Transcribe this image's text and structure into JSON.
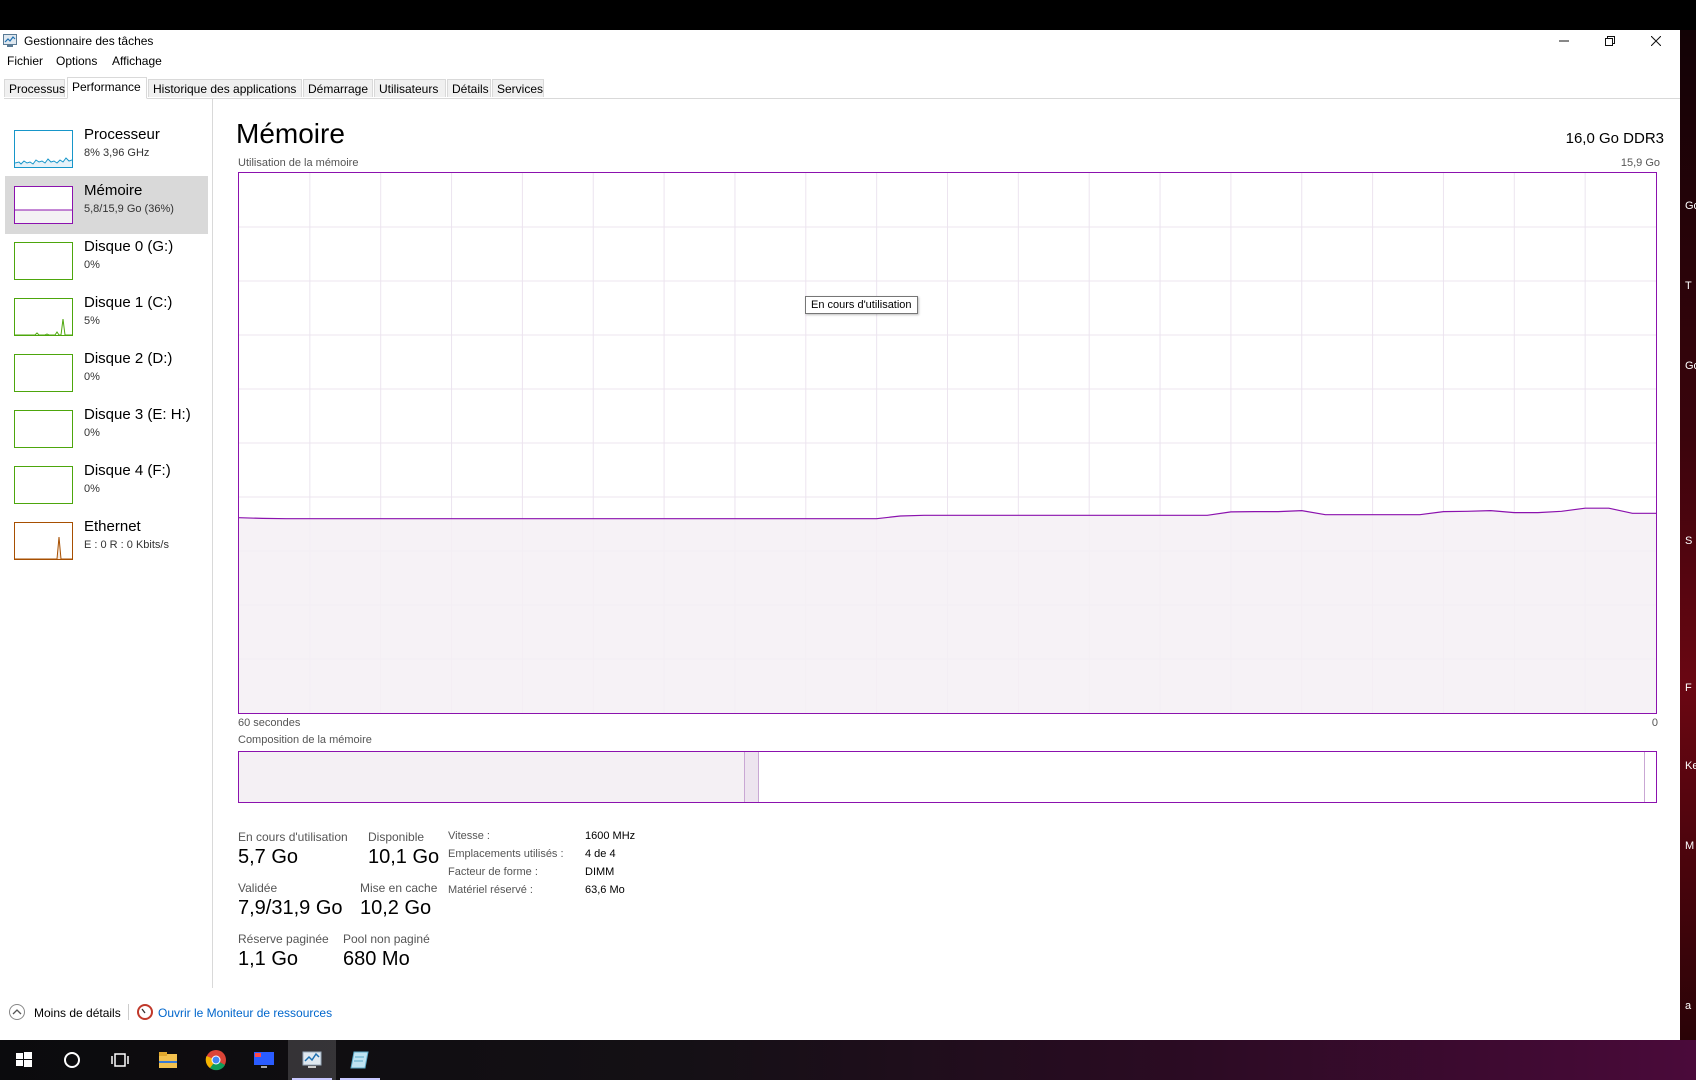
{
  "window": {
    "title": "Gestionnaire des tâches"
  },
  "menu": [
    "Fichier",
    "Options",
    "Affichage"
  ],
  "tabs": [
    "Processus",
    "Performance",
    "Historique des applications",
    "Démarrage",
    "Utilisateurs",
    "Détails",
    "Services"
  ],
  "active_tab": "Performance",
  "sidebar": [
    {
      "title": "Processeur",
      "sub": "8% 3,96 GHz",
      "color": "#1796c9",
      "selected": false
    },
    {
      "title": "Mémoire",
      "sub": "5,8/15,9 Go (36%)",
      "color": "#8b12ae",
      "selected": true
    },
    {
      "title": "Disque 0 (G:)",
      "sub": "0%",
      "color": "#4da60c",
      "selected": false
    },
    {
      "title": "Disque 1 (C:)",
      "sub": "5%",
      "color": "#4da60c",
      "selected": false
    },
    {
      "title": "Disque 2 (D:)",
      "sub": "0%",
      "color": "#4da60c",
      "selected": false
    },
    {
      "title": "Disque 3 (E: H:)",
      "sub": "0%",
      "color": "#4da60c",
      "selected": false
    },
    {
      "title": "Disque 4 (F:)",
      "sub": "0%",
      "color": "#4da60c",
      "selected": false
    },
    {
      "title": "Ethernet",
      "sub": "E : 0 R : 0 Kbits/s",
      "color": "#a74f01",
      "selected": false
    }
  ],
  "main": {
    "title": "Mémoire",
    "spec": "16,0 Go DDR3",
    "usage_label": "Utilisation de la mémoire",
    "usage_max": "15,9 Go",
    "time_left": "60 secondes",
    "time_right": "0",
    "tooltip": "En cours d'utilisation",
    "composition_label": "Composition de la mémoire"
  },
  "chart_data": {
    "type": "area",
    "title": "Utilisation de la mémoire",
    "xlabel": "",
    "ylabel": "",
    "ylim": [
      0,
      15.9
    ],
    "xlim": [
      60,
      0
    ],
    "grid": true,
    "color": "#8b12ae",
    "series": [
      {
        "values": [
          5.75,
          5.73,
          5.72,
          5.72,
          5.72,
          5.72,
          5.72,
          5.72,
          5.72,
          5.72,
          5.72,
          5.72,
          5.72,
          5.72,
          5.72,
          5.72,
          5.72,
          5.72,
          5.72,
          5.72,
          5.72,
          5.72,
          5.72,
          5.72,
          5.72,
          5.72,
          5.72,
          5.72,
          5.8,
          5.82,
          5.82,
          5.82,
          5.82,
          5.82,
          5.82,
          5.82,
          5.82,
          5.82,
          5.82,
          5.82,
          5.82,
          5.82,
          5.92,
          5.93,
          5.93,
          5.96,
          5.84,
          5.84,
          5.84,
          5.84,
          5.84,
          5.93,
          5.94,
          5.96,
          5.9,
          5.9,
          5.94,
          6.03,
          6.03,
          5.88,
          5.88
        ]
      }
    ]
  },
  "composition": {
    "in_use_fraction": 0.357,
    "modified_fraction": 0.01,
    "standby_fraction": 0.625,
    "free_fraction": 0.008
  },
  "stats": {
    "in_use_label": "En cours d'utilisation",
    "in_use_value": "5,7 Go",
    "available_label": "Disponible",
    "available_value": "10,1 Go",
    "committed_label": "Validée",
    "committed_value": "7,9/31,9 Go",
    "cached_label": "Mise en cache",
    "cached_value": "10,2 Go",
    "paged_label": "Réserve paginée",
    "paged_value": "1,1 Go",
    "nonpaged_label": "Pool non paginé",
    "nonpaged_value": "680 Mo"
  },
  "specs": {
    "speed_label": "Vitesse :",
    "speed_value": "1600 MHz",
    "slots_label": "Emplacements utilisés :",
    "slots_value": "4 de 4",
    "form_label": "Facteur de forme :",
    "form_value": "DIMM",
    "reserved_label": "Matériel réservé :",
    "reserved_value": "63,6 Mo"
  },
  "footer": {
    "less_details": "Moins de détails",
    "resource_monitor": "Ouvrir le Moniteur de ressources"
  },
  "desktop_right_text": [
    "Go",
    "T",
    "Go",
    "S",
    "F",
    "Ke",
    "M",
    "a"
  ]
}
